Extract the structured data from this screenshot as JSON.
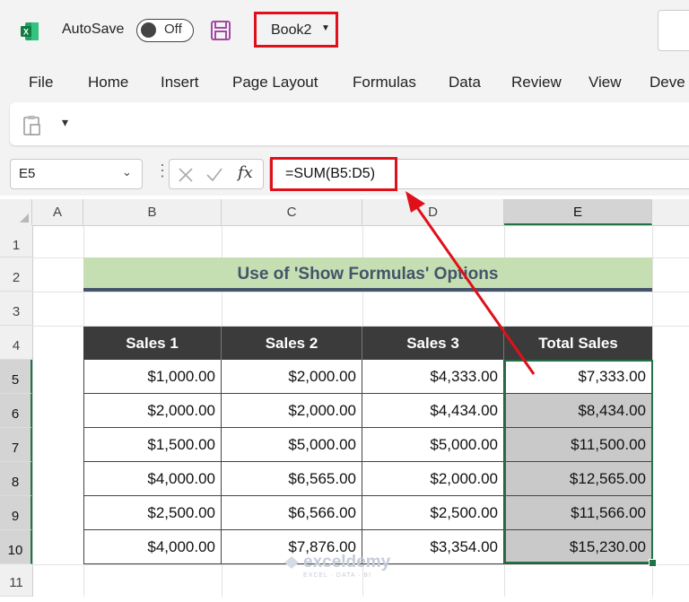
{
  "titlebar": {
    "autosave_label": "AutoSave",
    "toggle_state": "Off",
    "book_name": "Book2"
  },
  "menu": [
    "File",
    "Home",
    "Insert",
    "Page Layout",
    "Formulas",
    "Data",
    "Review",
    "View",
    "Deve"
  ],
  "formula_bar": {
    "name_box": "E5",
    "fx_label": "fx",
    "formula": "=SUM(B5:D5)"
  },
  "columns": [
    "A",
    "B",
    "C",
    "D",
    "E"
  ],
  "rows": [
    "1",
    "2",
    "3",
    "4",
    "5",
    "6",
    "7",
    "8",
    "9",
    "10",
    "11"
  ],
  "sheet": {
    "title": "Use of 'Show Formulas' Options",
    "headers": [
      "Sales 1",
      "Sales 2",
      "Sales 3",
      "Total Sales"
    ],
    "data": [
      [
        "$1,000.00",
        "$2,000.00",
        "$4,333.00",
        "$7,333.00"
      ],
      [
        "$2,000.00",
        "$2,000.00",
        "$4,434.00",
        "$8,434.00"
      ],
      [
        "$1,500.00",
        "$5,000.00",
        "$5,000.00",
        "$11,500.00"
      ],
      [
        "$4,000.00",
        "$6,565.00",
        "$2,000.00",
        "$12,565.00"
      ],
      [
        "$2,500.00",
        "$6,566.00",
        "$2,500.00",
        "$11,566.00"
      ],
      [
        "$4,000.00",
        "$7,876.00",
        "$3,354.00",
        "$15,230.00"
      ]
    ]
  },
  "watermark": {
    "name": "exceldemy",
    "tagline": "EXCEL · DATA · BI"
  },
  "colors": {
    "highlight_red": "#e0101a",
    "excel_green": "#217346",
    "title_fill": "#c6dfb2",
    "header_fill": "#3b3b3b",
    "title_text": "#44546a"
  }
}
